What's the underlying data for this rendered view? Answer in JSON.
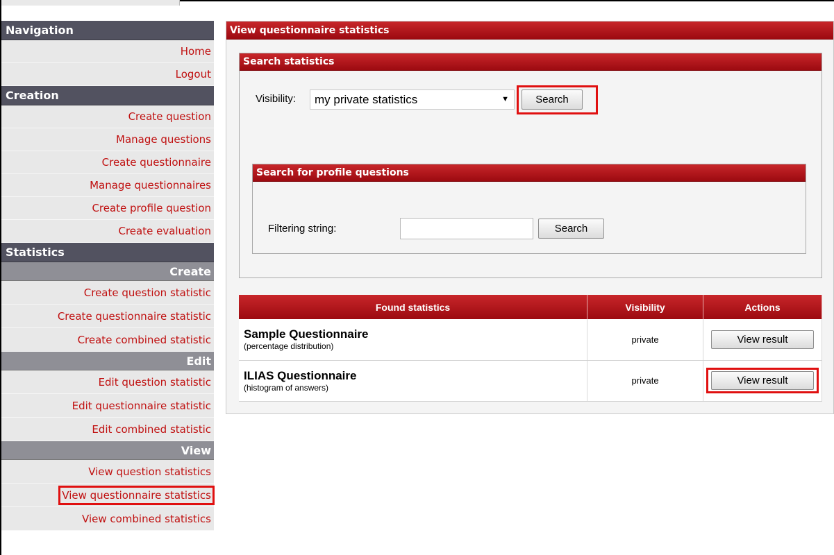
{
  "sidebar": {
    "navigation_header": "Navigation",
    "navigation_items": [
      "Home",
      "Logout"
    ],
    "creation_header": "Creation",
    "creation_items": [
      "Create question",
      "Manage questions",
      "Create questionnaire",
      "Manage questionnaires",
      "Create profile question",
      "Create evaluation"
    ],
    "statistics_header": "Statistics",
    "create_sub": "Create",
    "create_items": [
      "Create question statistic",
      "Create questionnaire statistic",
      "Create combined statistic"
    ],
    "edit_sub": "Edit",
    "edit_items": [
      "Edit question statistic",
      "Edit questionnaire statistic",
      "Edit combined statistic"
    ],
    "view_sub": "View",
    "view_items": [
      "View question statistics",
      "View questionnaire statistics",
      "View combined statistics"
    ]
  },
  "main": {
    "title": "View questionnaire statistics",
    "search_statistics": {
      "title": "Search statistics",
      "visibility_label": "Visibility:",
      "visibility_value": "my private statistics",
      "search_button": "Search"
    },
    "profile_search": {
      "title": "Search for profile questions",
      "filter_label": "Filtering string:",
      "filter_value": "",
      "search_button": "Search"
    },
    "results": {
      "headers": [
        "Found statistics",
        "Visibility",
        "Actions"
      ],
      "rows": [
        {
          "title": "Sample Questionnaire",
          "subtitle": "(percentage distribution)",
          "visibility": "private",
          "action": "View result"
        },
        {
          "title": "ILIAS Questionnaire",
          "subtitle": "(histogram of answers)",
          "visibility": "private",
          "action": "View result"
        }
      ]
    }
  },
  "colors": {
    "accent_red": "#b01318",
    "sidebar_header": "#525260",
    "sidebar_sub": "#8f8f96",
    "link_red": "#c01010",
    "highlight": "#e01010"
  }
}
